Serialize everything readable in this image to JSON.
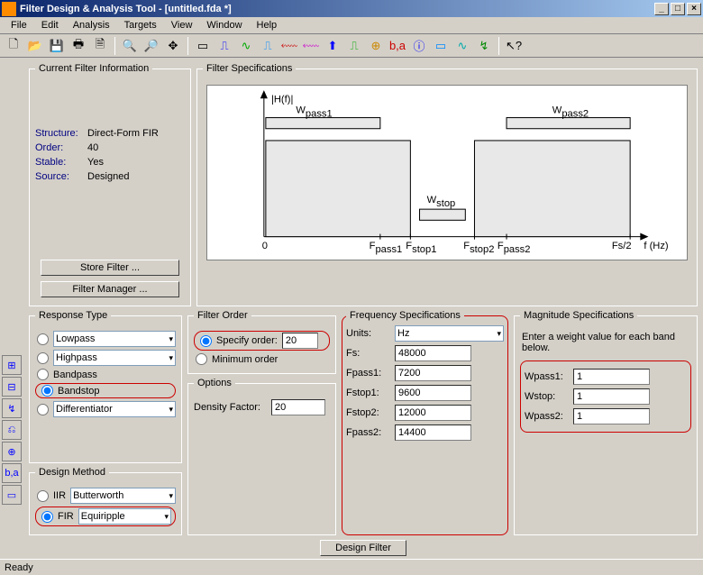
{
  "window": {
    "title": "Filter Design & Analysis Tool  -  [untitled.fda *]",
    "minimize": "_",
    "maximize": "□",
    "close": "×"
  },
  "menu": [
    "File",
    "Edit",
    "Analysis",
    "Targets",
    "View",
    "Window",
    "Help"
  ],
  "current_filter": {
    "legend": "Current Filter Information",
    "structure_label": "Structure:",
    "structure": "Direct-Form FIR",
    "order_label": "Order:",
    "order": "40",
    "stable_label": "Stable:",
    "stable": "Yes",
    "source_label": "Source:",
    "source": "Designed",
    "store_btn": "Store Filter ...",
    "manager_btn": "Filter Manager ..."
  },
  "filter_spec": {
    "legend": "Filter Specifications",
    "ylabel": "|H(f)|",
    "wpass1": "W",
    "wpass1_sub": "pass1",
    "wpass2": "W",
    "wpass2_sub": "pass2",
    "wstop": "W",
    "wstop_sub": "stop",
    "x0": "0",
    "fpass1": "F",
    "fpass1_sub": "pass1",
    "fstop1": "F",
    "fstop1_sub": "stop1",
    "fstop2": "F",
    "fstop2_sub": "stop2",
    "fpass2": "F",
    "fpass2_sub": "pass2",
    "fs2": "Fs/2",
    "xunit": "f (Hz)"
  },
  "response": {
    "legend": "Response Type",
    "lowpass": "Lowpass",
    "highpass": "Highpass",
    "bandpass": "Bandpass",
    "bandstop": "Bandstop",
    "differentiator": "Differentiator"
  },
  "design_method": {
    "legend": "Design Method",
    "iir": "IIR",
    "iir_val": "Butterworth",
    "fir": "FIR",
    "fir_val": "Equiripple"
  },
  "filter_order": {
    "legend": "Filter Order",
    "specify": "Specify order:",
    "specify_val": "20",
    "minimum": "Minimum order"
  },
  "options": {
    "legend": "Options",
    "density": "Density Factor:",
    "density_val": "20"
  },
  "freq": {
    "legend": "Frequency Specifications",
    "units": "Units:",
    "units_val": "Hz",
    "fs": "Fs:",
    "fs_val": "48000",
    "fpass1": "Fpass1:",
    "fpass1_val": "7200",
    "fstop1": "Fstop1:",
    "fstop1_val": "9600",
    "fstop2": "Fstop2:",
    "fstop2_val": "12000",
    "fpass2": "Fpass2:",
    "fpass2_val": "14400"
  },
  "mag": {
    "legend": "Magnitude Specifications",
    "hint": "Enter a weight value for each band below.",
    "wpass1": "Wpass1:",
    "wpass1_val": "1",
    "wstop": "Wstop:",
    "wstop_val": "1",
    "wpass2": "Wpass2:",
    "wpass2_val": "1"
  },
  "design_btn": "Design Filter",
  "status": "Ready",
  "chart_data": {
    "type": "line",
    "title": "Bandstop filter magnitude specification |H(f)|",
    "xlabel": "f (Hz)",
    "ylabel": "|H(f)|",
    "x_ticks": [
      "0",
      "Fpass1",
      "Fstop1",
      "Fstop2",
      "Fpass2",
      "Fs/2"
    ],
    "bands": [
      {
        "name": "pass1",
        "from": "0",
        "to": "Fpass1",
        "level": "1",
        "ripple": "Wpass1"
      },
      {
        "name": "stop",
        "from": "Fstop1",
        "to": "Fstop2",
        "level": "0",
        "ripple": "Wstop"
      },
      {
        "name": "pass2",
        "from": "Fpass2",
        "to": "Fs/2",
        "level": "1",
        "ripple": "Wpass2"
      }
    ]
  }
}
